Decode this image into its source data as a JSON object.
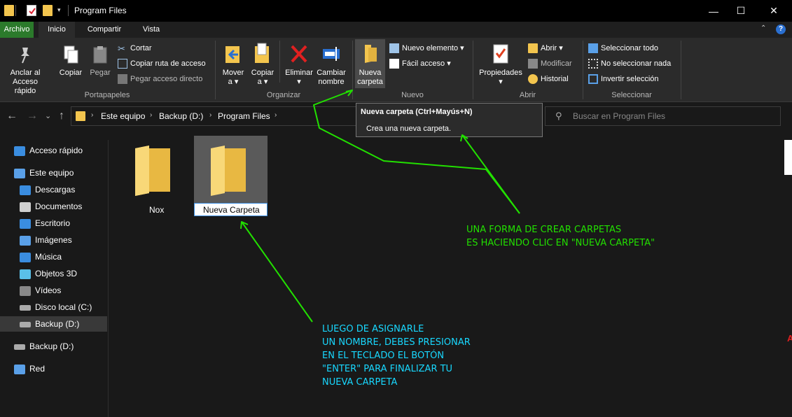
{
  "window": {
    "title": "Program Files",
    "controls": {
      "minimize": "—",
      "maximize": "☐",
      "close": "✕"
    }
  },
  "tabs": [
    {
      "label": "Archivo"
    },
    {
      "label": "Inicio"
    },
    {
      "label": "Compartir"
    },
    {
      "label": "Vista"
    }
  ],
  "ribbon": {
    "portapapeles": {
      "label": "Portapapeles",
      "anclar": "Anclar al\nAcceso rápido",
      "copiar": "Copiar",
      "pegar": "Pegar",
      "cortar": "Cortar",
      "copiar_ruta": "Copiar ruta de acceso",
      "pegar_acceso": "Pegar acceso directo"
    },
    "organizar": {
      "label": "Organizar",
      "mover": "Mover\na ▾",
      "copiar_a": "Copiar\na ▾",
      "eliminar": "Eliminar\n▾",
      "cambiar": "Cambiar\nnombre"
    },
    "nuevo": {
      "label": "Nuevo",
      "nueva_carpeta": "Nueva\ncarpeta",
      "nuevo_elemento": "Nuevo elemento ▾",
      "facil_acceso": "Fácil acceso ▾"
    },
    "abrir": {
      "label": "Abrir",
      "propiedades": "Propiedades\n▾",
      "abrir": "Abrir ▾",
      "modificar": "Modificar",
      "historial": "Historial"
    },
    "seleccionar": {
      "label": "Seleccionar",
      "todo": "Seleccionar todo",
      "nada": "No seleccionar nada",
      "invertir": "Invertir selección"
    }
  },
  "address": {
    "crumbs": [
      "Este equipo",
      "Backup (D:)",
      "Program Files"
    ],
    "search_placeholder": "Buscar en Program Files"
  },
  "tooltip": {
    "title": "Nueva carpeta (Ctrl+Mayús+N)",
    "description": "Crea una nueva carpeta."
  },
  "nav": {
    "items": [
      {
        "label": "Acceso rápido",
        "icon": "star-icon",
        "color": "#3a8de0"
      },
      {
        "label": "Este equipo",
        "icon": "computer-icon",
        "color": "#5aa0e8"
      },
      {
        "label": "Descargas",
        "icon": "download-icon",
        "color": "#3a8de0"
      },
      {
        "label": "Documentos",
        "icon": "document-icon",
        "color": "#d0d0d0"
      },
      {
        "label": "Escritorio",
        "icon": "desktop-icon",
        "color": "#3a8de0"
      },
      {
        "label": "Imágenes",
        "icon": "image-icon",
        "color": "#5aa0e8"
      },
      {
        "label": "Música",
        "icon": "music-icon",
        "color": "#3a8de0"
      },
      {
        "label": "Objetos 3D",
        "icon": "cube-icon",
        "color": "#5ac0e8"
      },
      {
        "label": "Vídeos",
        "icon": "video-icon",
        "color": "#888888"
      },
      {
        "label": "Disco local (C:)",
        "icon": "drive-icon",
        "color": "#aaaaaa"
      },
      {
        "label": "Backup (D:)",
        "icon": "drive-icon",
        "color": "#aaaaaa"
      },
      {
        "label": "Backup (D:)",
        "icon": "drive-icon",
        "color": "#aaaaaa"
      },
      {
        "label": "Red",
        "icon": "network-icon",
        "color": "#5aa0e8"
      }
    ]
  },
  "files": [
    {
      "name": "Nox"
    },
    {
      "name": "Nueva Carpeta"
    }
  ],
  "annotations": {
    "top": "UNA FORMA DE CREAR CARPETAS\nES HACIENDO CLIC EN \"NUEVA CARPETA\"",
    "bottom": "LUEGO DE ASIGNARLE\nUN NOMBRE, DEBES PRESIONAR\nEN EL TECLADO EL BOTÓN\n\"ENTER\" PARA FINALIZAR TU\nNUEVA CARPETA",
    "colors": {
      "green": "#22e000",
      "cyan": "#18d8ff"
    }
  }
}
